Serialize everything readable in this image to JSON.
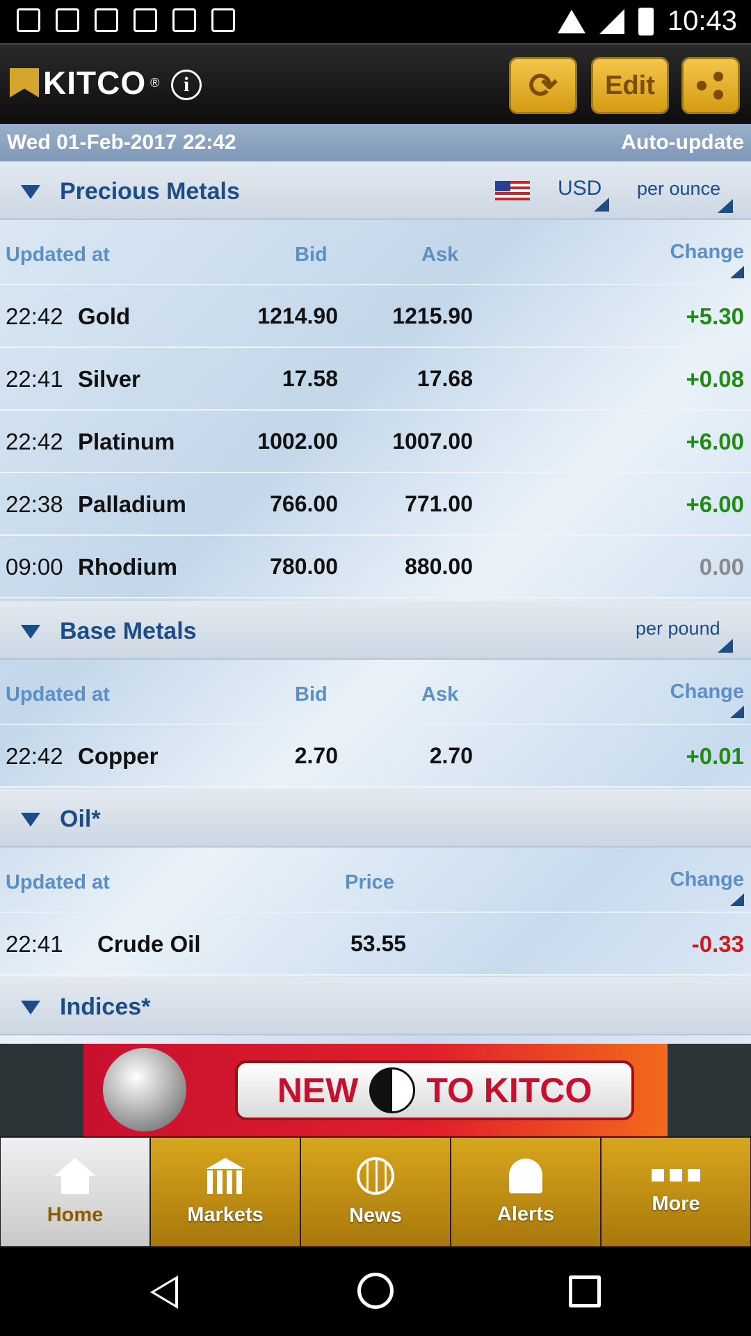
{
  "status_bar": {
    "time": "10:43"
  },
  "header": {
    "logo_text": "KITCO",
    "logo_reg": "®",
    "info_label": "i",
    "refresh_glyph": "⟳",
    "edit_label": "Edit"
  },
  "datebar": {
    "date": "Wed 01-Feb-2017 22:42",
    "auto_update": "Auto-update"
  },
  "precious": {
    "title": "Precious Metals",
    "currency": "USD",
    "unit": "per ounce",
    "headers": {
      "updated": "Updated at",
      "bid": "Bid",
      "ask": "Ask",
      "change": "Change"
    },
    "rows": [
      {
        "time": "22:42",
        "name": "Gold",
        "bid": "1214.90",
        "ask": "1215.90",
        "change": "+5.30"
      },
      {
        "time": "22:41",
        "name": "Silver",
        "bid": "17.58",
        "ask": "17.68",
        "change": "+0.08"
      },
      {
        "time": "22:42",
        "name": "Platinum",
        "bid": "1002.00",
        "ask": "1007.00",
        "change": "+6.00"
      },
      {
        "time": "22:38",
        "name": "Palladium",
        "bid": "766.00",
        "ask": "771.00",
        "change": "+6.00"
      },
      {
        "time": "09:00",
        "name": "Rhodium",
        "bid": "780.00",
        "ask": "880.00",
        "change": "0.00"
      }
    ]
  },
  "base": {
    "title": "Base Metals",
    "unit": "per pound",
    "headers": {
      "updated": "Updated at",
      "bid": "Bid",
      "ask": "Ask",
      "change": "Change"
    },
    "rows": [
      {
        "time": "22:42",
        "name": "Copper",
        "bid": "2.70",
        "ask": "2.70",
        "change": "+0.01"
      }
    ]
  },
  "oil": {
    "title": "Oil*",
    "headers": {
      "updated": "Updated at",
      "price": "Price",
      "change": "Change"
    },
    "rows": [
      {
        "time": "22:41",
        "name": "Crude Oil",
        "price": "53.55",
        "change": "-0.33"
      }
    ]
  },
  "indices": {
    "title": "Indices*"
  },
  "ad": {
    "text_left": "NEW",
    "text_right": "TO KITCO"
  },
  "tabs": [
    {
      "label": "Home",
      "icon": "home-icon"
    },
    {
      "label": "Markets",
      "icon": "bank-icon"
    },
    {
      "label": "News",
      "icon": "globe-icon"
    },
    {
      "label": "Alerts",
      "icon": "bell-icon"
    },
    {
      "label": "More",
      "icon": "more-icon"
    }
  ],
  "colors": {
    "accent": "#1d4d86",
    "gold": "#d59b12",
    "positive": "#1f8c12",
    "negative": "#d7181b"
  }
}
